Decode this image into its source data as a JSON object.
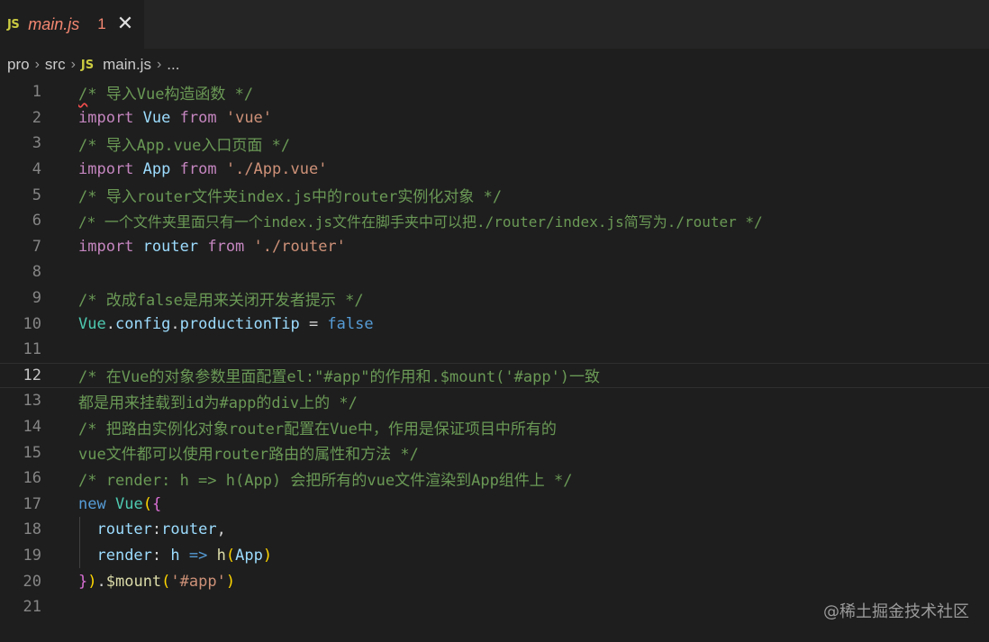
{
  "tab": {
    "badge": "JS",
    "filename": "main.js",
    "problems": "1",
    "close": "✕"
  },
  "breadcrumb": {
    "items": [
      "pro",
      "src",
      "main.js",
      "..."
    ],
    "badge": "JS"
  },
  "editor": {
    "lines": [
      "1",
      "2",
      "3",
      "4",
      "5",
      "6",
      "7",
      "8",
      "9",
      "10",
      "11",
      "12",
      "13",
      "14",
      "15",
      "16",
      "17",
      "18",
      "19",
      "20",
      "21"
    ],
    "code": {
      "l1_rest": "* 导入Vue构造函数 */",
      "l2_import": "import",
      "l2_name": "Vue",
      "l2_from": "from",
      "l2_str": "'vue'",
      "l3": "/* 导入App.vue入口页面 */",
      "l4_import": "import",
      "l4_name": "App",
      "l4_from": "from",
      "l4_str": "'./App.vue'",
      "l5": "/* 导入router文件夹index.js中的router实例化对象 */",
      "l6": "/* 一个文件夹里面只有一个index.js文件在脚手夹中可以把./router/index.js简写为./router */",
      "l7_import": "import",
      "l7_name": "router",
      "l7_from": "from",
      "l7_str": "'./router'",
      "l9": "/* 改成false是用来关闭开发者提示 */",
      "l10_vue": "Vue",
      "l10_config": "config",
      "l10_prop": "productionTip",
      "l10_val": "false",
      "l12": "/* 在Vue的对象参数里面配置el:\"#app\"的作用和.$mount('#app')一致",
      "l13": "都是用来挂载到id为#app的div上的 */",
      "l14": "/* 把路由实例化对象router配置在Vue中，作用是保证项目中所有的",
      "l15": "vue文件都可以使用router路由的属性和方法 */",
      "l16": "/* render: h => h(App) 会把所有的vue文件渲染到App组件上 */",
      "l17_new": "new",
      "l17_vue": "Vue",
      "l18_key": "router",
      "l18_val": "router",
      "l19_key": "render",
      "l19_h": "h",
      "l19_fn": "h",
      "l19_arg": "App",
      "l20_mount": "$mount",
      "l20_str": "'#app'"
    }
  },
  "watermark": "@稀土掘金技术社区",
  "colors": {
    "background": "#1e1e1e",
    "comment": "#6a9955",
    "keyword": "#c586c0",
    "variable": "#9cdcfe",
    "string": "#ce9178",
    "boolean": "#569cd6",
    "error_tab": "#f48771"
  }
}
